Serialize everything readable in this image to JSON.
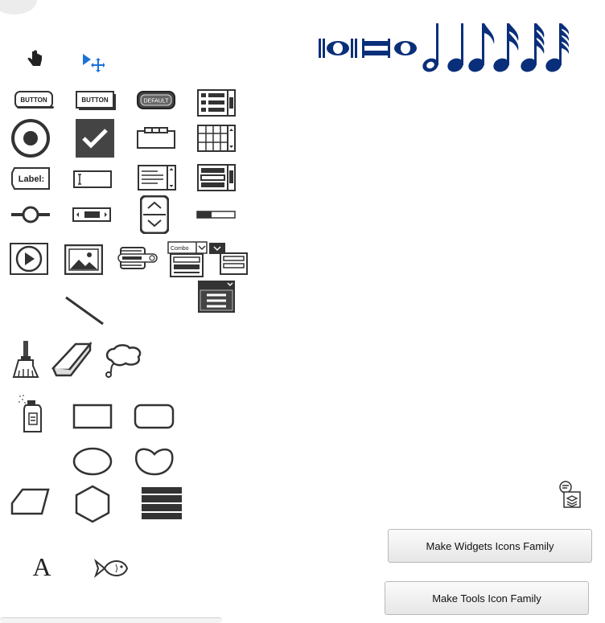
{
  "colors": {
    "icon_dark": "#333333",
    "music_blue": "#0a2f7a",
    "pointer_blue": "#1a73d9"
  },
  "widget_icons": {
    "button_label": "BUTTON",
    "button2_label": "BUTTON",
    "default_button_label": "DEFAULT",
    "label_text": "Label:",
    "combo_text": "Combo"
  },
  "actions": {
    "make_widgets": "Make Widgets Icons Family",
    "make_tools": "Make Tools Icon Family"
  }
}
